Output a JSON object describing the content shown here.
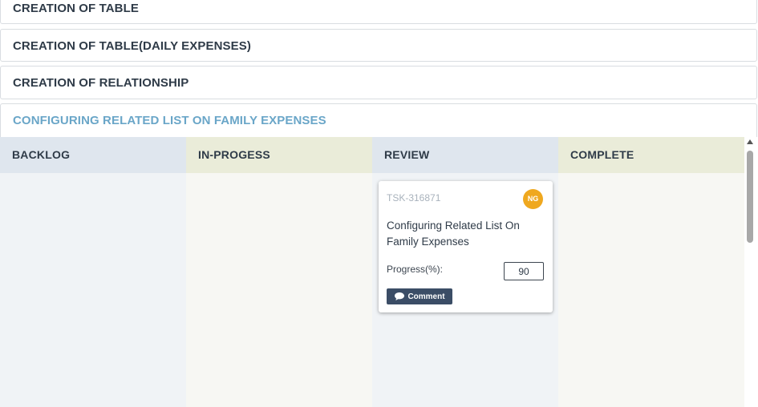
{
  "accordions": [
    {
      "title": "CREATION OF TABLE"
    },
    {
      "title": "CREATION OF TABLE(DAILY EXPENSES)"
    },
    {
      "title": "CREATION OF RELATIONSHIP"
    },
    {
      "title": "CONFIGURING RELATED LIST ON FAMILY EXPENSES",
      "expanded": true,
      "title_color": "#6aa6c8"
    }
  ],
  "board": {
    "columns": [
      {
        "label": "BACKLOG"
      },
      {
        "label": "IN-PROGESS"
      },
      {
        "label": "REVIEW"
      },
      {
        "label": "COMPLETE"
      }
    ]
  },
  "card": {
    "column": "REVIEW",
    "id": "TSK-316871",
    "avatar_initials": "NG",
    "avatar_color": "#efa81f",
    "title": "Configuring Related List On Family Expenses",
    "progress_label": "Progress(%):",
    "progress_value": "90",
    "comment_label": "Comment",
    "comment_icon": "speech-bubble-icon"
  }
}
